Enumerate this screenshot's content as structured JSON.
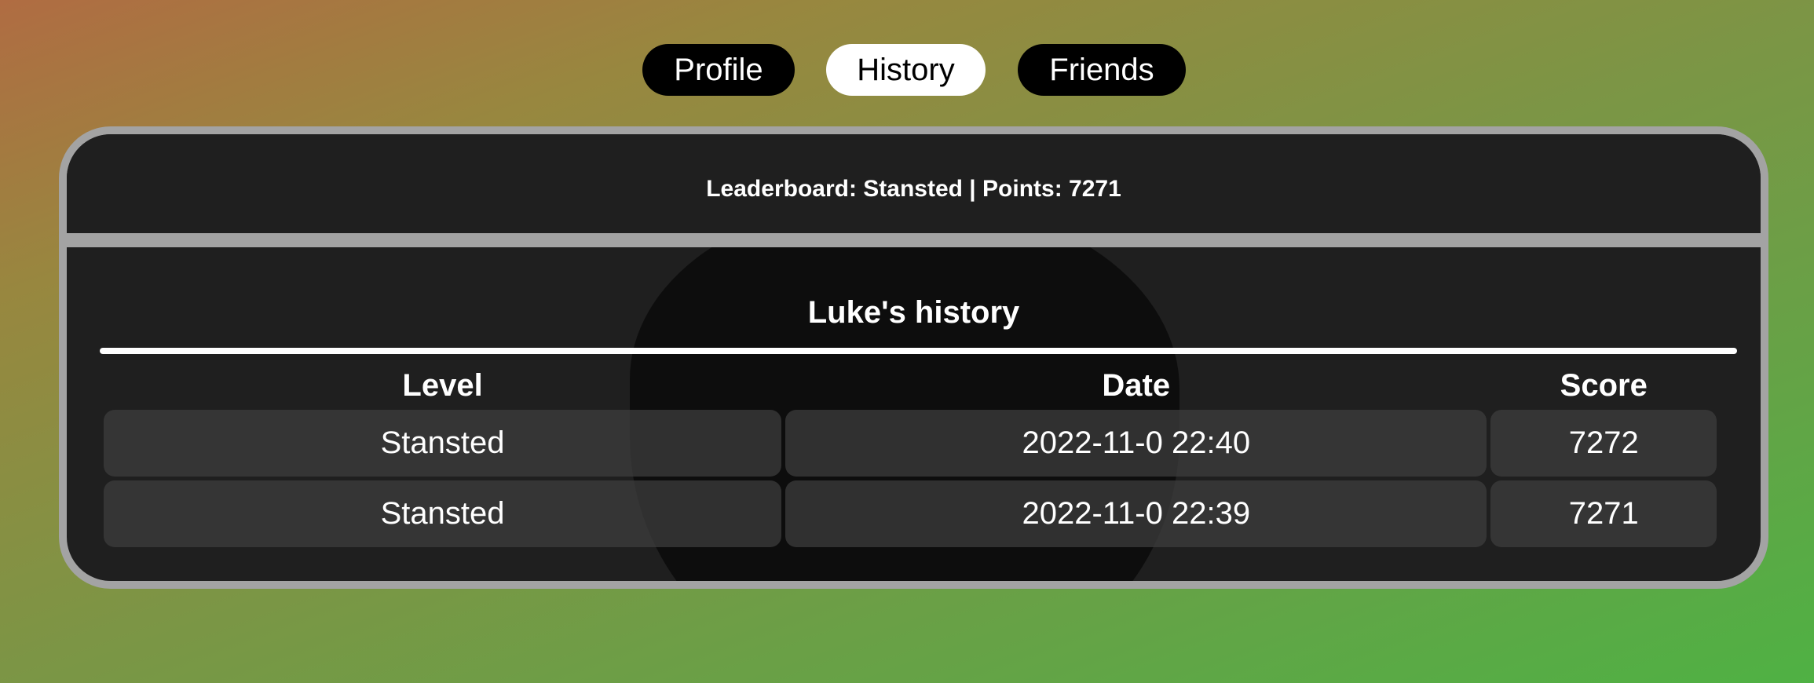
{
  "tabs": [
    {
      "label": "Profile",
      "active": false
    },
    {
      "label": "History",
      "active": true
    },
    {
      "label": "Friends",
      "active": false
    }
  ],
  "leaderboard": {
    "text": "Leaderboard: Stansted | Points: 7271"
  },
  "history": {
    "title": "Luke's history",
    "columns": [
      "Level",
      "Date",
      "Score"
    ],
    "rows": [
      {
        "level": "Stansted",
        "date": "2022-11-0 22:40",
        "score": "7272"
      },
      {
        "level": "Stansted",
        "date": "2022-11-0 22:39",
        "score": "7271"
      }
    ]
  },
  "colors": {
    "tab_active_bg": "#ffffff",
    "tab_inactive_bg": "#000000",
    "panel_bg": "#1f1f1f",
    "panel_border": "#a3a3a3"
  }
}
